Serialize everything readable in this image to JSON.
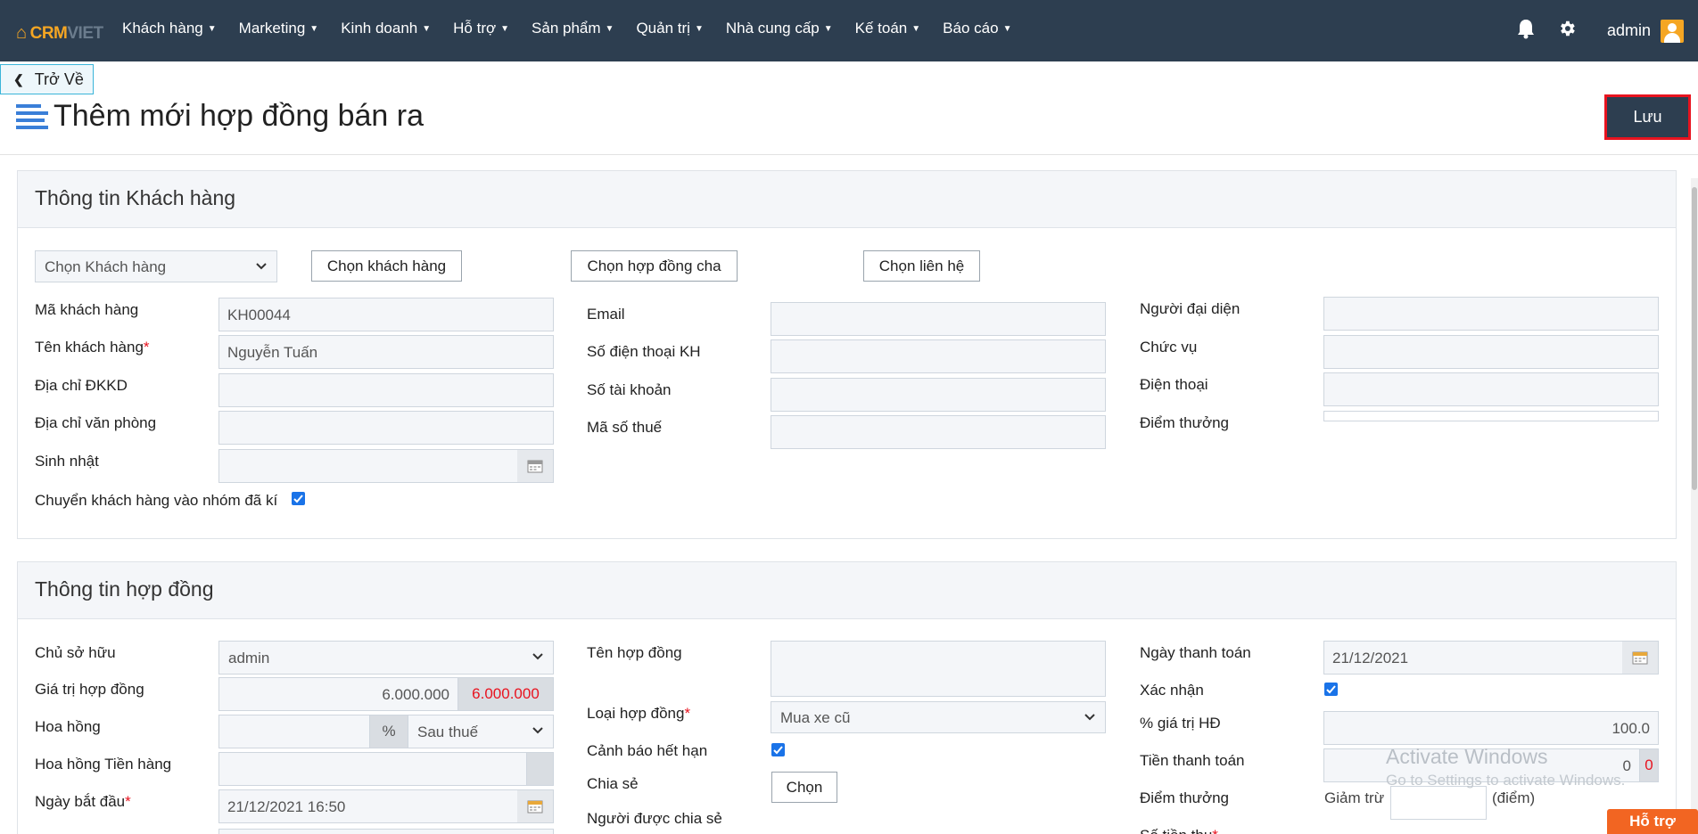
{
  "brand": {
    "crm": "CRM",
    "viet": "VIET"
  },
  "nav": [
    {
      "label": "Khách hàng"
    },
    {
      "label": "Marketing"
    },
    {
      "label": "Kinh doanh"
    },
    {
      "label": "Hỗ trợ"
    },
    {
      "label": "Sản phẩm"
    },
    {
      "label": "Quản trị"
    },
    {
      "label": "Nhà cung cấp"
    },
    {
      "label": "Kế toán"
    },
    {
      "label": "Báo cáo"
    }
  ],
  "user": {
    "name": "admin"
  },
  "back_label": "Trở Về",
  "page_title": "Thêm mới hợp đồng bán ra",
  "save_label": "Lưu",
  "customer": {
    "heading": "Thông tin Khách hàng",
    "select_customer": "Chọn Khách hàng",
    "btn_choose_customer": "Chọn khách hàng",
    "btn_choose_parent": "Chọn hợp đồng cha",
    "btn_choose_contact": "Chọn liên hệ",
    "code_label": "Mã khách hàng",
    "code_value": "KH00044",
    "name_label": "Tên khách hàng",
    "name_value": "Nguyễn Tuấn",
    "addr_reg_label": "Địa chỉ ĐKKD",
    "addr_office_label": "Địa chỉ văn phòng",
    "birthday_label": "Sinh nhật",
    "move_group_label": "Chuyển khách hàng vào nhóm đã kí",
    "email_label": "Email",
    "phone_label": "Số điện thoại KH",
    "account_label": "Số tài khoản",
    "tax_label": "Mã số thuế",
    "rep_label": "Người đại diện",
    "position_label": "Chức vụ",
    "rep_phone_label": "Điện thoại",
    "points_label": "Điểm thưởng"
  },
  "contract": {
    "heading": "Thông tin hợp đồng",
    "owner_label": "Chủ sở hữu",
    "owner_value": "admin",
    "value_label": "Giá trị hợp đồng",
    "value_value": "6.000.000",
    "value_total": "6.000.000",
    "commission_label": "Hoa hồng",
    "percent_sign": "%",
    "after_tax": "Sau thuế",
    "commission_goods_label": "Hoa hồng Tiền hàng",
    "start_label": "Ngày bắt đầu",
    "start_value": "21/12/2021 16:50",
    "name_label": "Tên hợp đồng",
    "type_label": "Loại hợp đồng",
    "type_value": "Mua xe cũ",
    "expiry_warn_label": "Cảnh báo hết hạn",
    "share_label": "Chia sẻ",
    "share_btn": "Chọn",
    "shared_with_label": "Người được chia sẻ",
    "pay_date_label": "Ngày thanh toán",
    "pay_date_value": "21/12/2021",
    "confirm_label": "Xác nhận",
    "percent_label": "% giá trị HĐ",
    "percent_value": "100.0",
    "pay_amount_label": "Tiền thanh toán",
    "pay_amount_value": "0",
    "pay_amount_remain": "0",
    "points_label": "Điểm thưởng",
    "deduct_label": "Giảm trừ",
    "points_unit": "(điểm)",
    "collect_label": "Số tiền thu"
  },
  "watermark": {
    "line1": "Activate Windows",
    "line2": "Go to Settings to activate Windows."
  },
  "help_label": "Hỗ trợ",
  "colors": {
    "nav_bg": "#2d3e50",
    "accent": "#f5a623",
    "required": "#e8131f",
    "help": "#f26522"
  }
}
